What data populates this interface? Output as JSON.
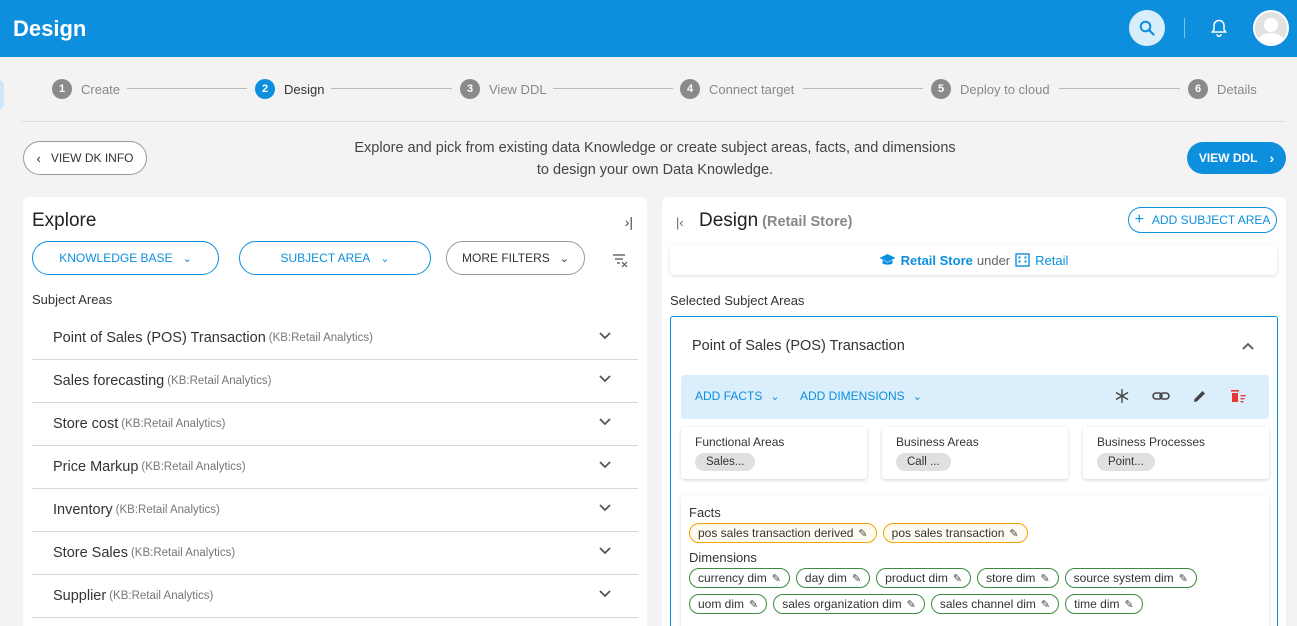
{
  "header": {
    "title": "Design"
  },
  "stepper": {
    "steps": [
      {
        "num": "1",
        "label": "Create"
      },
      {
        "num": "2",
        "label": "Design"
      },
      {
        "num": "3",
        "label": "View DDL"
      },
      {
        "num": "4",
        "label": "Connect target"
      },
      {
        "num": "5",
        "label": "Deploy to cloud"
      },
      {
        "num": "6",
        "label": "Details"
      }
    ],
    "active_step": "2"
  },
  "intro": {
    "back_label": "VIEW DK INFO",
    "line1": "Explore and pick from existing data Knowledge or create subject areas, facts, and dimensions",
    "line2": "to design your own Data Knowledge.",
    "view_ddl_label": "VIEW DDL"
  },
  "explore": {
    "title": "Explore",
    "filters": {
      "knowledge_base": "KNOWLEDGE BASE",
      "subject_area": "SUBJECT AREA",
      "more_filters": "MORE FILTERS"
    },
    "subject_areas_label": "Subject Areas",
    "items": [
      {
        "name": "Point of Sales (POS) Transaction",
        "kb": "(KB:Retail Analytics)"
      },
      {
        "name": "Sales forecasting",
        "kb": "(KB:Retail Analytics)"
      },
      {
        "name": "Store cost",
        "kb": "(KB:Retail Analytics)"
      },
      {
        "name": "Price Markup",
        "kb": "(KB:Retail Analytics)"
      },
      {
        "name": "Inventory",
        "kb": "(KB:Retail Analytics)"
      },
      {
        "name": "Store Sales",
        "kb": "(KB:Retail Analytics)"
      },
      {
        "name": "Supplier",
        "kb": "(KB:Retail Analytics)"
      }
    ]
  },
  "design": {
    "title": "Design",
    "subtitle": "(Retail Store)",
    "add_subject_area": "ADD SUBJECT AREA",
    "breadcrumb": {
      "store": "Retail Store",
      "under": "under",
      "parent": "Retail"
    },
    "selected_label": "Selected Subject Areas",
    "card": {
      "title": "Point of Sales (POS) Transaction",
      "add_facts": "ADD FACTS",
      "add_dimensions": "ADD DIMENSIONS",
      "functional_areas": {
        "label": "Functional Areas",
        "value": "Sales..."
      },
      "business_areas": {
        "label": "Business Areas",
        "value": "Call ..."
      },
      "business_processes": {
        "label": "Business Processes",
        "value": "Point..."
      },
      "facts_label": "Facts",
      "facts": [
        "pos sales transaction derived",
        "pos sales transaction"
      ],
      "dimensions_label": "Dimensions",
      "dimensions_row1": [
        "currency dim",
        "day dim",
        "product dim",
        "store dim",
        "source system dim"
      ],
      "dimensions_row2": [
        "uom dim",
        "sales organization dim",
        "sales channel dim",
        "time dim"
      ]
    }
  },
  "colors": {
    "primary": "#0d8fde",
    "fact_border": "#f0a500",
    "dim_border": "#3b8a3e",
    "delete": "#e53935"
  }
}
